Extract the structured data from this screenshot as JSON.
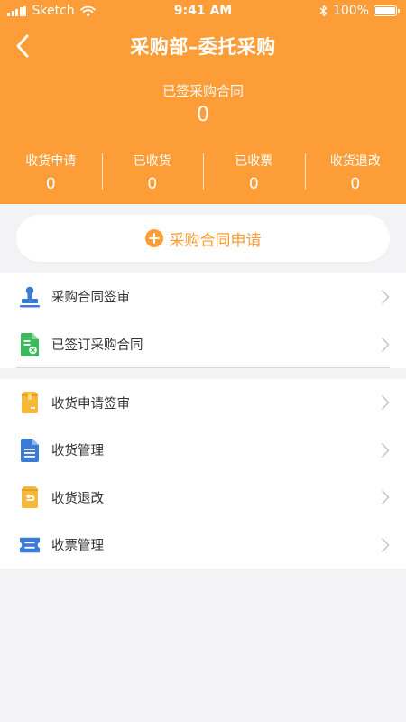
{
  "status_bar": {
    "carrier": "Sketch",
    "time": "9:41 AM",
    "battery": "100%"
  },
  "nav": {
    "title": "采购部–委托采购"
  },
  "summary": {
    "signed_label": "已签采购合同",
    "signed_value": "0",
    "stats": [
      {
        "label": "收货申请",
        "value": "0"
      },
      {
        "label": "已收货",
        "value": "0"
      },
      {
        "label": "已收票",
        "value": "0"
      },
      {
        "label": "收货退改",
        "value": "0"
      }
    ]
  },
  "apply_button": {
    "label": "采购合同申请"
  },
  "menu_group_1": [
    {
      "label": "采购合同签审",
      "icon": "stamp-icon",
      "color": "#3a7bd5"
    },
    {
      "label": "已签订采购合同",
      "icon": "signed-document-icon",
      "color": "#3cb95c"
    }
  ],
  "menu_group_2": [
    {
      "label": "收货申请签审",
      "icon": "box-icon",
      "color": "#f5b83a"
    },
    {
      "label": "收货管理",
      "icon": "document-icon",
      "color": "#3a7bd5"
    },
    {
      "label": "收货退改",
      "icon": "return-box-icon",
      "color": "#f5b83a"
    },
    {
      "label": "收票管理",
      "icon": "ticket-icon",
      "color": "#3a7bd5"
    }
  ],
  "colors": {
    "header_bg": "#fc9d37",
    "accent": "#fc9d37",
    "page_bg": "#f3f3f5"
  }
}
